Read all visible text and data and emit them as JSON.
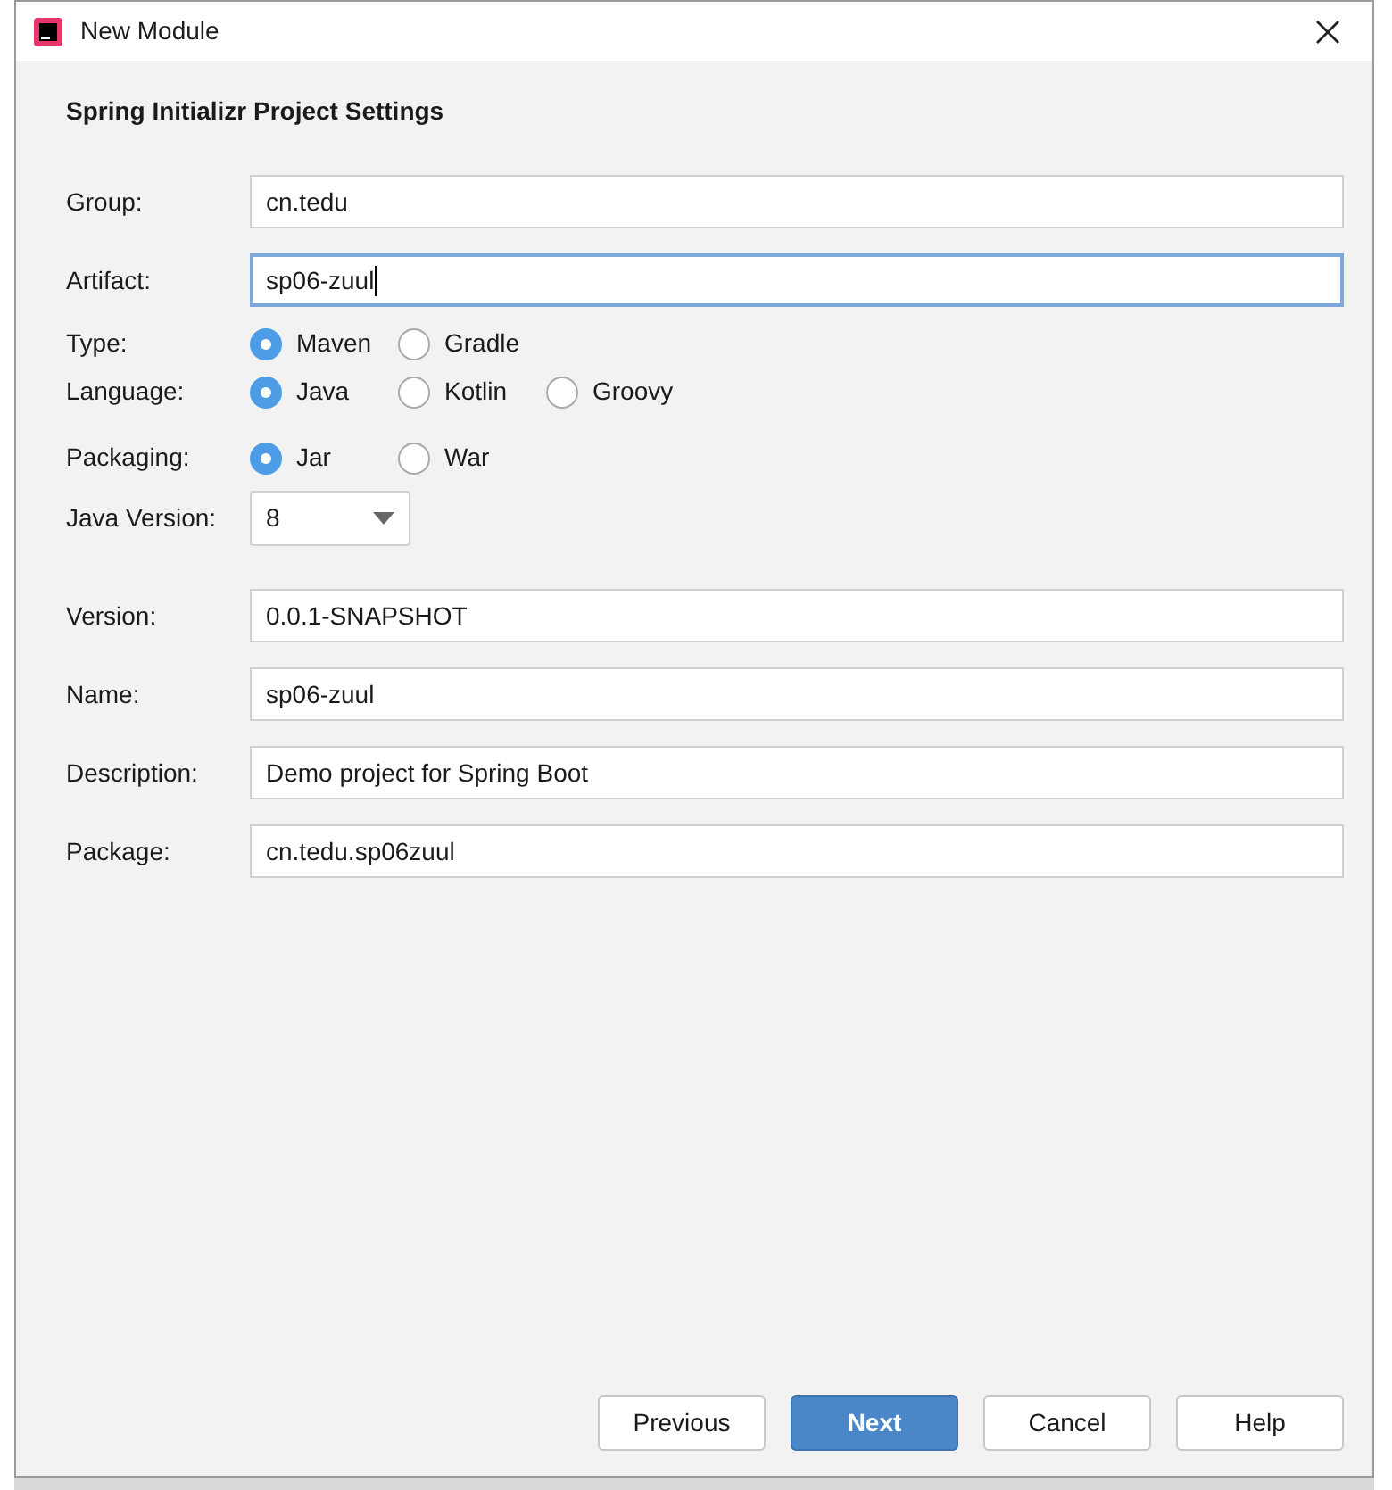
{
  "window": {
    "title": "New Module"
  },
  "heading": "Spring Initializr Project Settings",
  "fields": [
    {
      "kind": "text",
      "label": "Group:",
      "value": "cn.tedu",
      "focused": false
    },
    {
      "kind": "text",
      "label": "Artifact:",
      "value": "sp06-zuul",
      "focused": true
    },
    {
      "kind": "radio",
      "label": "Type:",
      "options": [
        {
          "label": "Maven",
          "selected": true
        },
        {
          "label": "Gradle",
          "selected": false
        }
      ]
    },
    {
      "kind": "radio",
      "label": "Language:",
      "options": [
        {
          "label": "Java",
          "selected": true
        },
        {
          "label": "Kotlin",
          "selected": false
        },
        {
          "label": "Groovy",
          "selected": false
        }
      ]
    },
    {
      "kind": "radio",
      "label": "Packaging:",
      "options": [
        {
          "label": "Jar",
          "selected": true
        },
        {
          "label": "War",
          "selected": false
        }
      ]
    },
    {
      "kind": "dropdown",
      "label": "Java Version:",
      "value": "8"
    },
    {
      "kind": "text",
      "label": "Version:",
      "value": "0.0.1-SNAPSHOT",
      "focused": false
    },
    {
      "kind": "text",
      "label": "Name:",
      "value": "sp06-zuul",
      "focused": false
    },
    {
      "kind": "text",
      "label": "Description:",
      "value": "Demo project for Spring Boot",
      "focused": false
    },
    {
      "kind": "text",
      "label": "Package:",
      "value": "cn.tedu.sp06zuul",
      "focused": false
    }
  ],
  "buttons": [
    {
      "label": "Previous",
      "primary": false
    },
    {
      "label": "Next",
      "primary": true
    },
    {
      "label": "Cancel",
      "primary": false
    },
    {
      "label": "Help",
      "primary": false
    }
  ]
}
